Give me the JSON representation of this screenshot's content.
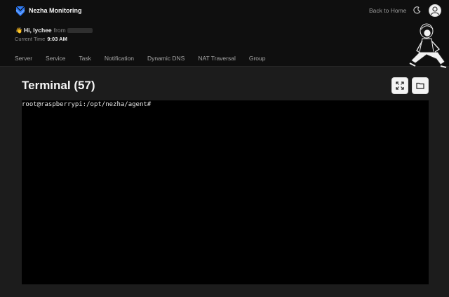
{
  "header": {
    "app_name": "Nezha Monitoring",
    "back_home": "Back to Home",
    "greeting": "Hi, lychee",
    "from_label": "from",
    "time_label": "Current Time",
    "time_value": "9:03 AM"
  },
  "nav": {
    "items": [
      "Server",
      "Service",
      "Task",
      "Notification",
      "Dynamic DNS",
      "NAT Traversal",
      "Group"
    ]
  },
  "page": {
    "title": "Terminal (57)"
  },
  "terminal": {
    "prompt": "root@raspberrypi:/opt/nezha/agent#"
  },
  "icons": {
    "logo": "nezha-logo-icon",
    "theme": "moon-icon",
    "avatar": "user-avatar-icon",
    "fullscreen": "expand-icon",
    "files": "folder-icon"
  },
  "colors": {
    "background": "#1c1c1c",
    "header": "#0f0f0f",
    "terminal": "#000000",
    "logo_blue": "#3b82f6"
  }
}
